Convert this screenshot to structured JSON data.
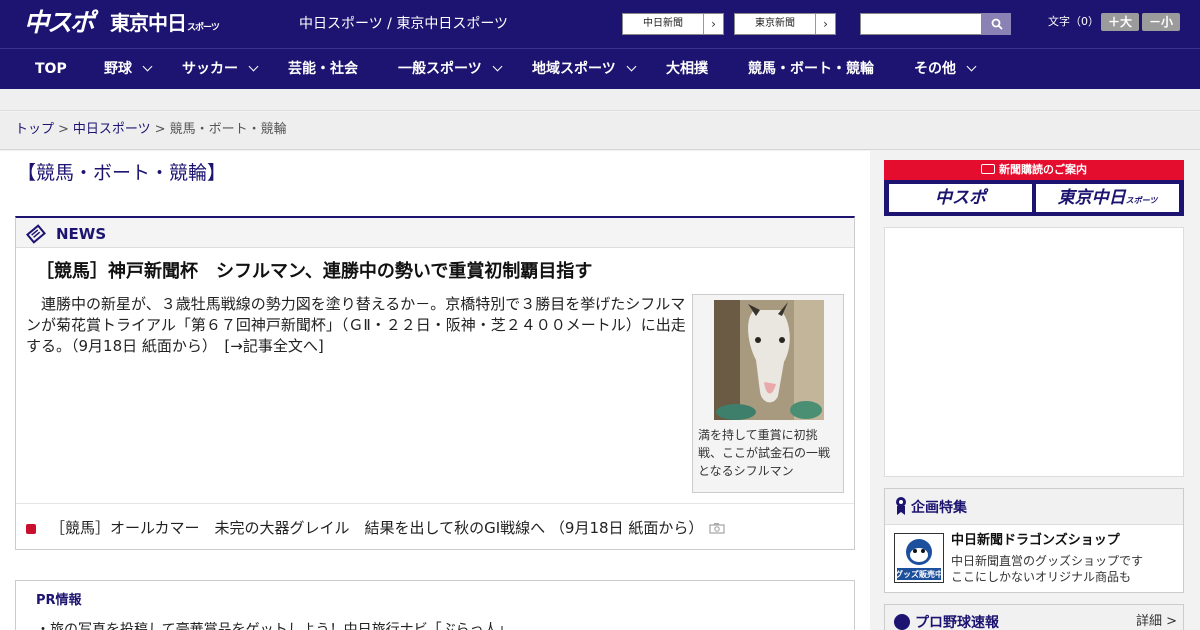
{
  "header": {
    "logo_main": "中スポ",
    "logo_tokyo": "東京中日",
    "logo_tokyo_small": "スポーツ",
    "site_names": "中日スポーツ / 東京中日スポーツ",
    "paper_links": [
      {
        "label": "中日新聞"
      },
      {
        "label": "東京新聞"
      }
    ],
    "search": {
      "placeholder": ""
    },
    "font_size_label": "文字（0）",
    "font_larger": "＋大",
    "font_smaller": "－小"
  },
  "nav": {
    "items": [
      {
        "label": "TOP",
        "dropdown": false
      },
      {
        "label": "野球",
        "dropdown": true
      },
      {
        "label": "サッカー",
        "dropdown": true
      },
      {
        "label": "芸能・社会",
        "dropdown": false
      },
      {
        "label": "一般スポーツ",
        "dropdown": true
      },
      {
        "label": "地域スポーツ",
        "dropdown": true
      },
      {
        "label": "大相撲",
        "dropdown": false
      },
      {
        "label": "競馬・ボート・競輪",
        "dropdown": false
      },
      {
        "label": "その他",
        "dropdown": true
      }
    ]
  },
  "breadcrumb": {
    "items": [
      "トップ",
      "中日スポーツ",
      "競馬・ボート・競輪"
    ],
    "separator": ">"
  },
  "page": {
    "title": "【競馬・ボート・競輪】"
  },
  "news": {
    "label": "NEWS",
    "headline": "［競馬］神戸新聞杯　シフルマン、連勝中の勢いで重賞初制覇目指す",
    "body": "連勝中の新星が、３歳牡馬戦線の勢力図を塗り替えるか－。京橋特別で３勝目を挙げたシフルマンが菊花賞トライアル「第６７回神戸新聞杯」（ＧⅡ・２２日・阪神・芝２４００メートル）に出走する。（9月18日 紙面から）　[→記事全文へ]",
    "photo_caption": "満を持して重賞に初挑戦、ここが試金石の一戦となるシフルマン",
    "links": [
      {
        "text": "［競馬］オールカマー　未完の大器グレイル　結果を出して秋のGI戦線へ （9月18日 紙面から）"
      }
    ]
  },
  "pr": {
    "label": "PR情報",
    "text": "・旅の写真を投稿して豪華賞品をゲットしよう！中日旅行ナビ「ぶらっ人」"
  },
  "sidebar": {
    "subscription": {
      "title": "新聞購読のご案内",
      "left": "中スポ",
      "right": "東京中日",
      "right_small": "スポーツ"
    },
    "feature": {
      "title": "企画特集",
      "shop_title": "中日新聞ドラゴンズショップ",
      "shop_desc_1": "中日新聞直営のグッズショップです",
      "shop_desc_2": "ここにしかないオリジナル商品も",
      "thumb_text": "グッズ販売中"
    },
    "baseball": {
      "title": "プロ野球速報",
      "more": "詳細 >"
    }
  },
  "colors": {
    "brand_navy": "#1c1470",
    "accent_red": "#e50d2e"
  }
}
